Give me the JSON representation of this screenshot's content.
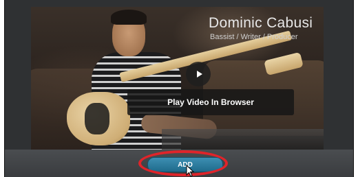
{
  "video": {
    "presenter_name": "Dominic Cabusi",
    "presenter_role": "Bassist / Writer / Producer",
    "play_browser_label": "Play Video In Browser"
  },
  "actions": {
    "add_label": "ADD"
  },
  "icons": {
    "play": "play-icon",
    "cursor": "mouse-pointer-icon"
  },
  "colors": {
    "accent_button": "#2a7fa3",
    "highlight_ring": "#e0242a",
    "panel_background": "#2f3133"
  }
}
